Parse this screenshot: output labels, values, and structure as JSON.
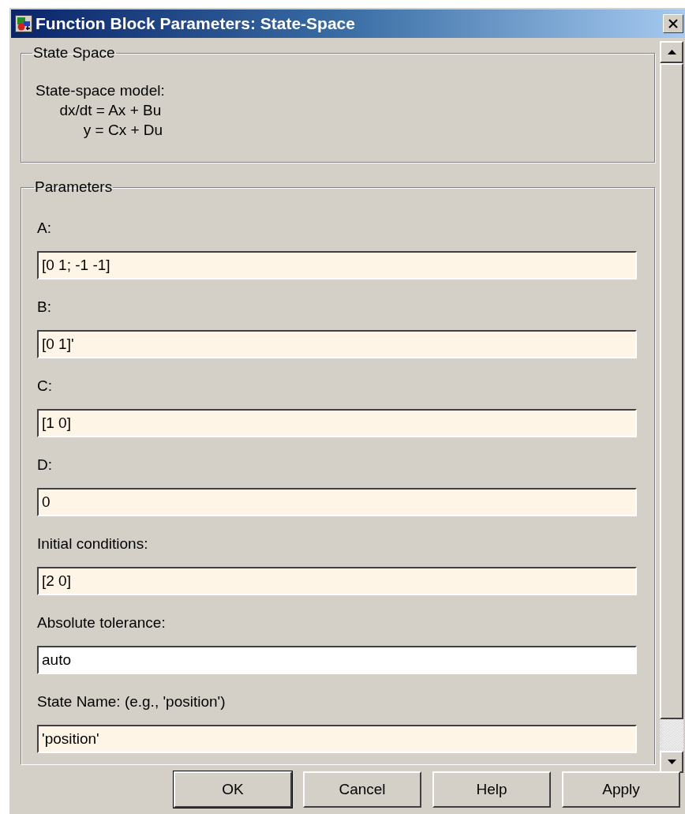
{
  "window": {
    "title": "Function Block Parameters: State-Space"
  },
  "description": {
    "group_title": "State Space",
    "lines": [
      "State-space model:",
      "dx/dt = Ax + Bu",
      "y = Cx + Du"
    ]
  },
  "parameters": {
    "group_title": "Parameters",
    "fields": [
      {
        "label": "A:",
        "value": "[0 1; -1 -1]",
        "tunable": true
      },
      {
        "label": "B:",
        "value": "[0 1]'",
        "tunable": true
      },
      {
        "label": "C:",
        "value": "[1 0]",
        "tunable": true
      },
      {
        "label": "D:",
        "value": "0",
        "tunable": true
      },
      {
        "label": "Initial conditions:",
        "value": "[2 0]",
        "tunable": true
      },
      {
        "label": "Absolute tolerance:",
        "value": "auto",
        "tunable": false
      },
      {
        "label": "State Name: (e.g., 'position')",
        "value": "'position'",
        "tunable": true
      }
    ]
  },
  "buttons": [
    "OK",
    "Cancel",
    "Help",
    "Apply"
  ]
}
